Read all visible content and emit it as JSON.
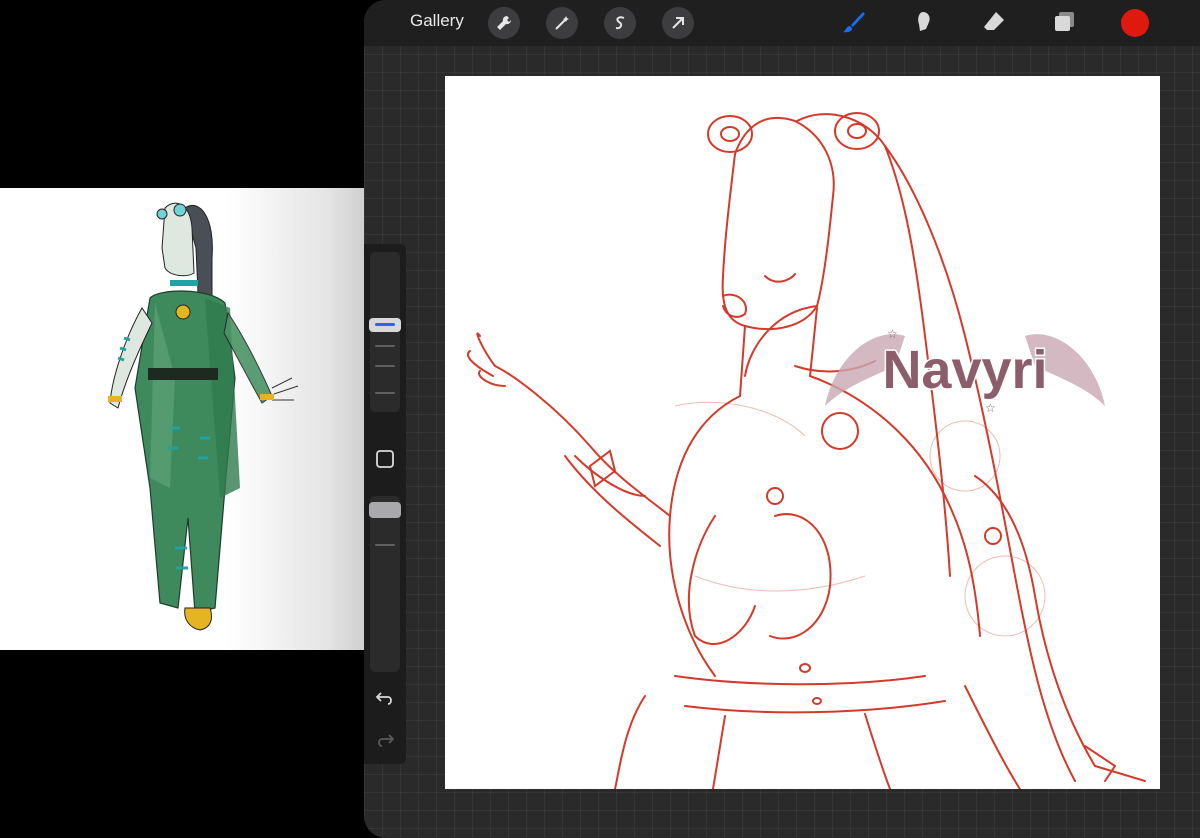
{
  "toolbar": {
    "gallery_label": "Gallery",
    "left_tools": [
      {
        "icon": "wrench-icon"
      },
      {
        "icon": "magic-wand-icon"
      },
      {
        "icon": "selection-s-icon"
      },
      {
        "icon": "move-arrow-icon"
      }
    ],
    "right_tools": [
      {
        "icon": "brush-icon",
        "active": true
      },
      {
        "icon": "smudge-icon"
      },
      {
        "icon": "eraser-icon"
      },
      {
        "icon": "layers-icon"
      }
    ],
    "current_color": "#e0190f",
    "active_color": "#1a6df0"
  },
  "sidebar": {
    "icons": [
      "modify-square-icon",
      "undo-icon",
      "redo-icon"
    ]
  },
  "watermark": {
    "text": "Navyri"
  },
  "colors": {
    "sketch": "#d43a2a",
    "app_bg": "#2a2a2b"
  }
}
